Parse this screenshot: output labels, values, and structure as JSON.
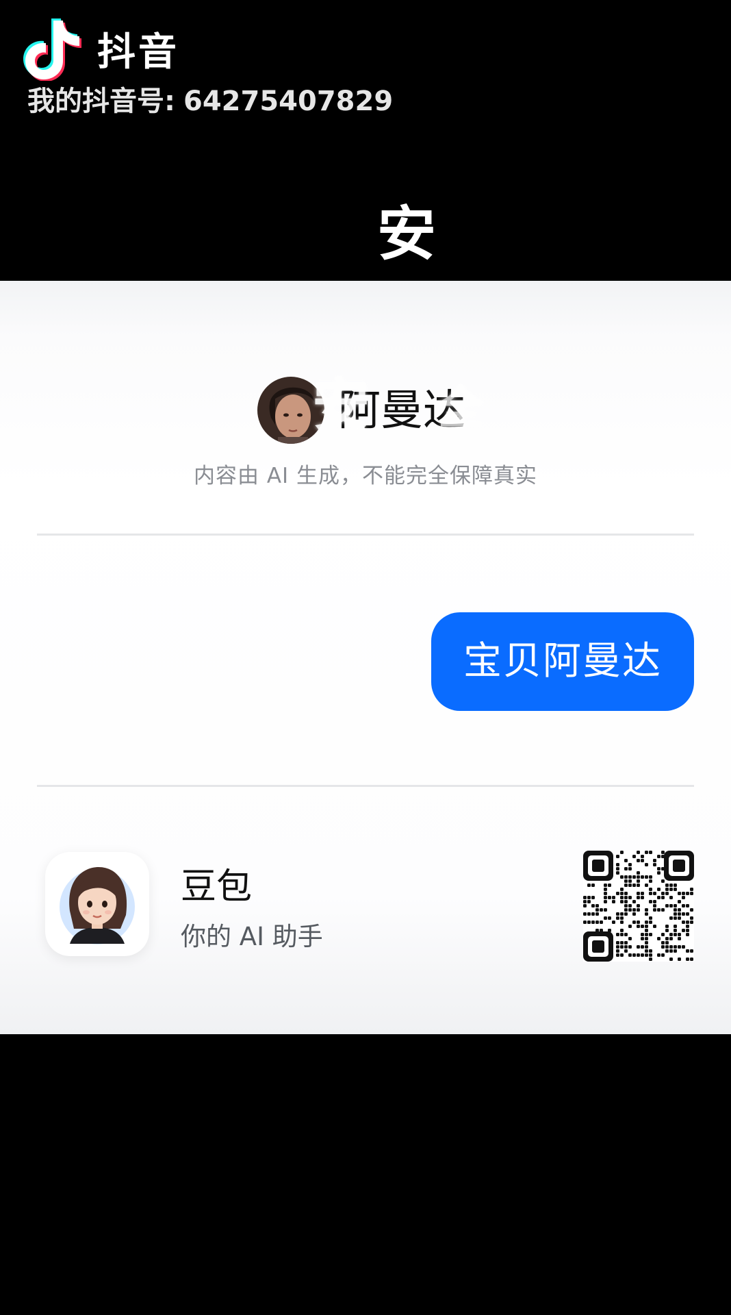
{
  "watermark": {
    "brand": "抖音",
    "id_label": "我的抖音号:",
    "id_value": "64275407829"
  },
  "caption_top": "安",
  "chat": {
    "header": {
      "name": "阿曼达",
      "overlay_chars": [
        "安",
        "全"
      ]
    },
    "disclaimer": "内容由 AI 生成，不能完全保障真实",
    "messages": [
      {
        "role": "user",
        "text": "宝贝阿曼达"
      }
    ]
  },
  "footer": {
    "app_name": "豆包",
    "app_tagline": "你的 AI 助手"
  },
  "colors": {
    "bubble": "#0a6cff",
    "background": "#000000",
    "card": "#ffffff",
    "disclaimer": "#8a8d93"
  },
  "icons": {
    "logo": "douyin-logo-icon",
    "qr": "qr-code-icon"
  }
}
